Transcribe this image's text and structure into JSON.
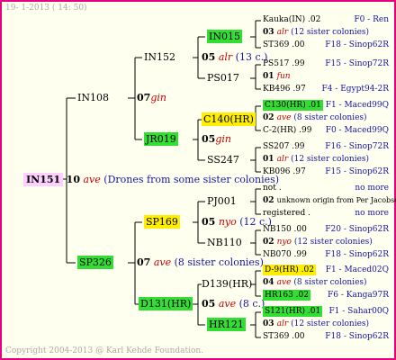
{
  "header": {
    "date": "19-  1-2013 ( 14: 50)"
  },
  "footer": {
    "copyright": "Copyright 2004-2013 @ Karl Kehde Foundation."
  },
  "root": {
    "id": "IN151",
    "num": "10",
    "name": "ave",
    "note": "(Drones from some sister colonies)"
  },
  "gen1": {
    "father": {
      "id": "IN108",
      "num": "07",
      "name": "gin"
    },
    "mother": {
      "id": "SP326",
      "num": "07",
      "name": "ave",
      "note": "(8 sister colonies)"
    }
  },
  "gen2": {
    "ff": {
      "id": "IN152",
      "num": "05",
      "name": "alr",
      "note": "(13 c.)"
    },
    "fm": {
      "id": "JR019",
      "num": "05",
      "name": "gin"
    },
    "mf": {
      "id": "SP169",
      "num": "05",
      "name": "nyo",
      "note": "(12 c.)"
    },
    "mm": {
      "id": "D131(HR)",
      "num": "05",
      "name": "ave",
      "note": "(8 c.)"
    }
  },
  "gen3": {
    "fff": "IN015",
    "ffm": "PS017",
    "fmf": "C140(HR)",
    "fmm": "SS247",
    "mff": "PJ001",
    "mfm": "NB110",
    "mmf": "D139(HR)",
    "mmm": "HR121"
  },
  "gen4": [
    {
      "a": "Kauka(IN) .02",
      "b": "F0 - Ren",
      "c_num": "03",
      "c_name": "alr",
      "c_note": "(12 sister colonies)",
      "d": "ST369 .00",
      "e": "F18 - Sinop62R"
    },
    {
      "a": "PS517 .99",
      "b": "F15 - Sinop72R",
      "c_num": "01",
      "c_name": "fun",
      "c_note": "",
      "d": "KB496 .97",
      "e": "F4 - Egypt94-2R"
    },
    {
      "a": "C130(HR) .01",
      "b": "F1 - Maced99Q",
      "c_num": "02",
      "c_name": "ave",
      "c_note": "(8 sister colonies)",
      "d": "C-2(HR) .99",
      "e": "F0 - Maced99Q"
    },
    {
      "a": "SS207 .99",
      "b": "F16 - Sinop72R",
      "c_num": "01",
      "c_name": "alr",
      "c_note": "(12 sister colonies)",
      "d": "KB096 .97",
      "e": "F15 - Sinop62R"
    },
    {
      "a": "not .",
      "b": "no more",
      "c_num": "02",
      "c_name": "",
      "c_note": "unknown origin from Per Jacobsen",
      "d": "registered .",
      "e": "no more"
    },
    {
      "a": "NB150 .00",
      "b": "F20 - Sinop62R",
      "c_num": "02",
      "c_name": "nyo",
      "c_note": "(12 sister colonies)",
      "d": "NB070 .99",
      "e": "F18 - Sinop62R"
    },
    {
      "a": "D-9(HR) .02",
      "b": "F1 - Maced02Q",
      "c_num": "04",
      "c_name": "ave",
      "c_note": "(8 sister colonies)",
      "d": "HR163 .02",
      "e": "F6 - Kanga97R"
    },
    {
      "a": "S121(HR) .01",
      "b": "F1 - Sahar00Q",
      "c_num": "03",
      "c_name": "alr",
      "c_note": "(12 sister colonies)",
      "d": "ST369 .00",
      "e": "F18 - Sinop62R"
    }
  ]
}
